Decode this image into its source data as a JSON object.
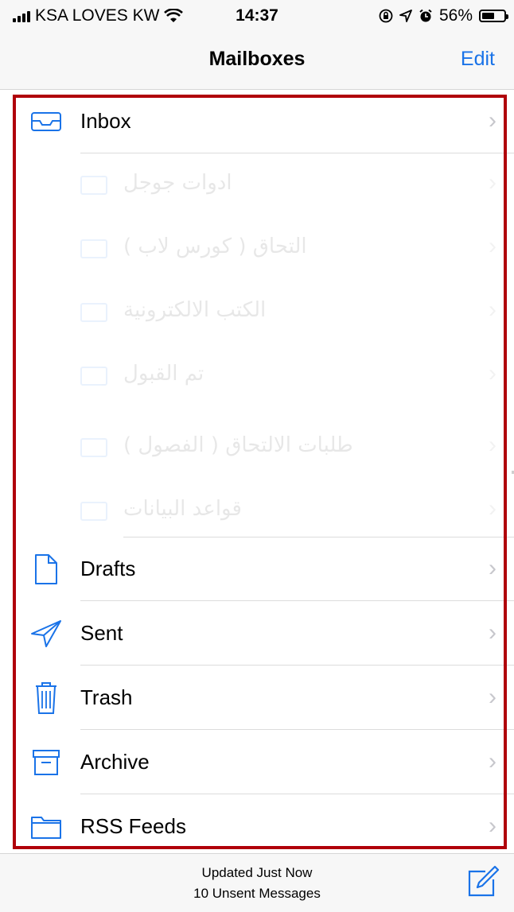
{
  "status_bar": {
    "carrier": "KSA LOVES KW",
    "time": "14:37",
    "battery": "56%",
    "battery_level": 0.56
  },
  "nav": {
    "title": "Mailboxes",
    "edit": "Edit"
  },
  "mailboxes": [
    {
      "label": "Inbox",
      "icon": "inbox-icon"
    },
    {
      "label": "Drafts",
      "icon": "drafts-icon"
    },
    {
      "label": "Sent",
      "icon": "sent-icon"
    },
    {
      "label": "Trash",
      "icon": "trash-icon"
    },
    {
      "label": "Archive",
      "icon": "archive-icon"
    },
    {
      "label": "RSS Feeds",
      "icon": "folder-icon"
    }
  ],
  "faded_folders": [
    "ادوات جوجل",
    "التحاق ( كورس لاب )",
    "الكتب الالكترونية",
    "تم القبول",
    "طلبات الالتحاق ( الفصول )",
    "قواعد البيانات"
  ],
  "footer": {
    "updated": "Updated Just Now",
    "unsent": "10 Unsent Messages"
  },
  "colors": {
    "accent": "#1a73e8",
    "highlight": "#b0000a"
  }
}
